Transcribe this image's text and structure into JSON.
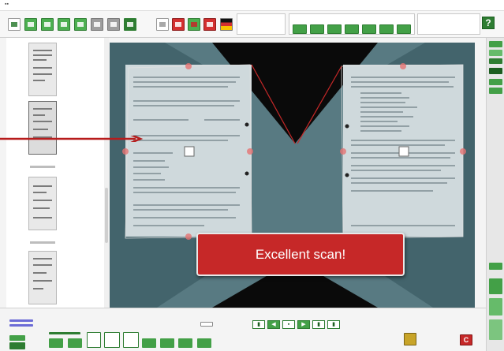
{
  "toast": {
    "message": "Excellent scan!"
  },
  "colors": {
    "accent_green": "#43a047",
    "dark_green": "#2e7d32",
    "toast_red": "#c62828",
    "arrow_red": "#b71c1c"
  },
  "icons": {
    "toolbar": [
      "scan-icon",
      "rotate-left-icon",
      "rotate-right-icon",
      "crop-icon",
      "split-icon",
      "image-icon",
      "edit-icon",
      "save-icon"
    ],
    "tools2": [
      "page-icon",
      "cancel-icon",
      "color-icon",
      "mode-icon",
      "language-flag-icon"
    ],
    "help": "help-icon",
    "nav": [
      "first-page-icon",
      "previous-page-icon",
      "current-page-icon",
      "next-page-icon",
      "last-page-icon"
    ],
    "bottom_right": [
      "folder-icon",
      "close-app-icon"
    ]
  }
}
